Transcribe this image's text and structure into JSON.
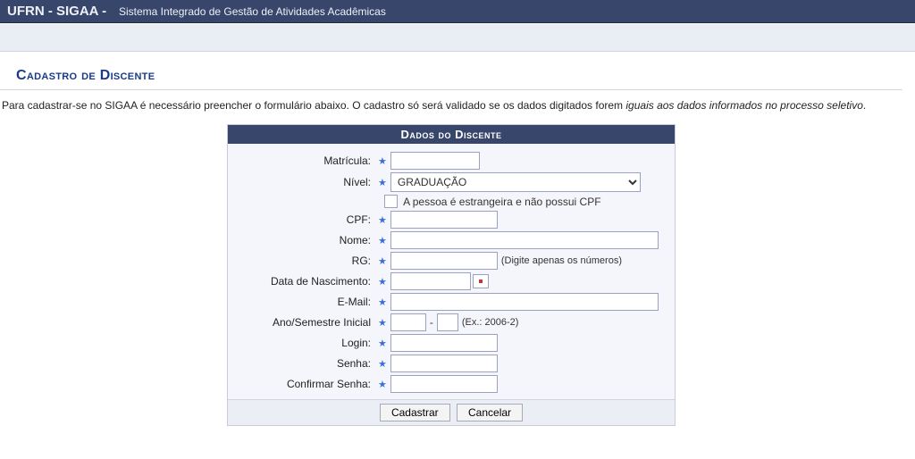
{
  "header": {
    "brand": "UFRN - SIGAA -",
    "subtitle": "Sistema Integrado de Gestão de Atividades Acadêmicas"
  },
  "section_title": "Cadastro de Discente",
  "intro": {
    "part1": "Para cadastrar-se no SIGAA é necessário preencher o formulário abaixo. O cadastro só será validado se os dados digitados forem ",
    "em": "iguais aos dados informados no processo seletivo",
    "part2": "."
  },
  "form": {
    "title": "Dados do Discente",
    "labels": {
      "matricula": "Matrícula:",
      "nivel": "Nível:",
      "estrangeiro": "A pessoa é estrangeira e não possui CPF",
      "cpf": "CPF:",
      "nome": "Nome:",
      "rg": "RG:",
      "rg_hint": "(Digite apenas os números)",
      "data_nasc": "Data de Nascimento:",
      "email": "E-Mail:",
      "ano_sem": "Ano/Semestre Inicial",
      "ano_sem_hint": "(Ex.: 2006-2)",
      "login": "Login:",
      "senha": "Senha:",
      "conf_senha": "Confirmar Senha:"
    },
    "values": {
      "nivel_selected": "GRADUAÇÃO",
      "sep": "-"
    },
    "buttons": {
      "submit": "Cadastrar",
      "cancel": "Cancelar"
    }
  }
}
